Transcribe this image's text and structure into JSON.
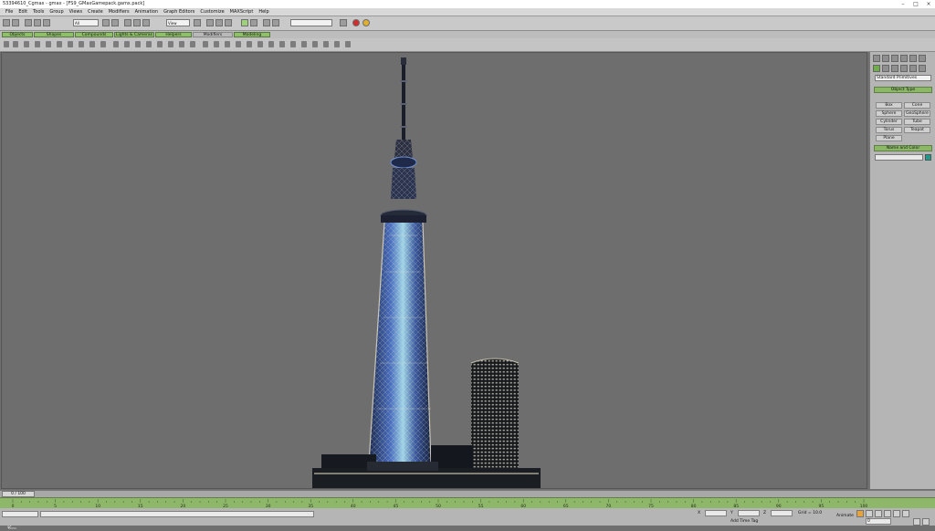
{
  "window": {
    "title": "53394610_Cgmax - gmax - [FS9_GMaxGamepack.gamx.pack]",
    "controls": [
      "–",
      "□",
      "×"
    ]
  },
  "menu": [
    "File",
    "Edit",
    "Tools",
    "Group",
    "Views",
    "Create",
    "Modifiers",
    "Animation",
    "Graph Editors",
    "Customize",
    "MAXScript",
    "Help"
  ],
  "toolbar": {
    "selection_filter": "All",
    "ref_coord": "View",
    "named_selection": ""
  },
  "tabs": [
    {
      "label": "Objects",
      "active": false
    },
    {
      "label": "Shapes",
      "active": false
    },
    {
      "label": "Compounds",
      "active": false
    },
    {
      "label": "Lights & Cameras",
      "active": false
    },
    {
      "label": "Helpers",
      "active": false
    },
    {
      "label": "Modifiers",
      "active": true
    },
    {
      "label": "Modeling",
      "active": false
    }
  ],
  "command_panel": {
    "category": "Standard Primitives",
    "object_type_title": "Object Type",
    "autogrid_label": "AutoGrid",
    "object_buttons": [
      "Box",
      "Cone",
      "Sphere",
      "GeoSphere",
      "Cylinder",
      "Tube",
      "Torus",
      "Teapot",
      "Plane"
    ],
    "name_color_title": "Name and Color",
    "name_value": "",
    "swatch_color": "#1c9a8c"
  },
  "timeline": {
    "frame_display": "0 / 100",
    "ticks": [
      "0",
      "5",
      "10",
      "15",
      "20",
      "25",
      "30",
      "35",
      "40",
      "45",
      "50",
      "55",
      "60",
      "65",
      "70",
      "75",
      "80",
      "85",
      "90",
      "95",
      "100"
    ]
  },
  "status": {
    "x_label": "X",
    "y_label": "Y",
    "z_label": "Z",
    "grid_text": "Grid = 10.0",
    "animate_label": "Animate",
    "add_time_tag": "Add Time Tag",
    "frame_field": "0"
  },
  "colors": {
    "accent_green": "#8fbf6a",
    "viewport_bg": "#6e6e6e",
    "tower_blue": "#4a6fbf",
    "tower_white": "#e8e0c8"
  }
}
